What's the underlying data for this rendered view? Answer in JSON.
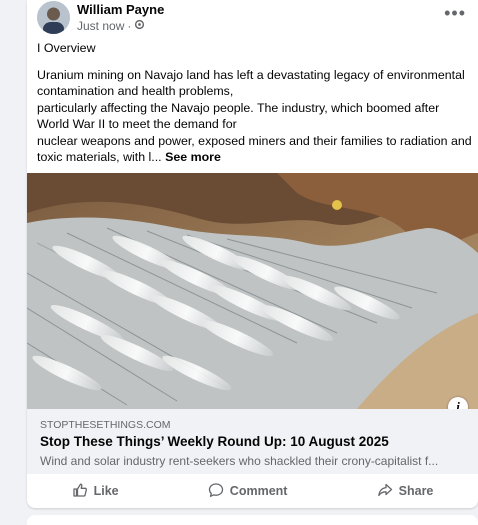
{
  "post": {
    "author": "William Payne",
    "timestamp": "Just now",
    "separator": "·",
    "audience_icon": "gear-icon",
    "menu_icon": "more-horizontal-icon",
    "heading": "I Overview",
    "body_lines": [
      "Uranium mining on Navajo land has left a devastating legacy of environmental contamination and health problems,",
      "particularly affecting the Navajo people. The industry, which boomed after World War II to meet the demand for",
      "nuclear weapons and power, exposed miners and their families to radiation and toxic materials, with l..."
    ],
    "see_more": "See more"
  },
  "link_preview": {
    "domain": "STOPTHESETHINGS.COM",
    "title": "Stop These Things’ Weekly Round Up: 10 August 2025",
    "description": "Wind and solar industry rent-seekers who shackled their crony-capitalist f...",
    "info_icon": "info-icon",
    "image_alt": "Aerial view of discarded wind turbine blades stacked in a dirt landfill pit"
  },
  "actions": {
    "like": "Like",
    "comment": "Comment",
    "share": "Share"
  }
}
